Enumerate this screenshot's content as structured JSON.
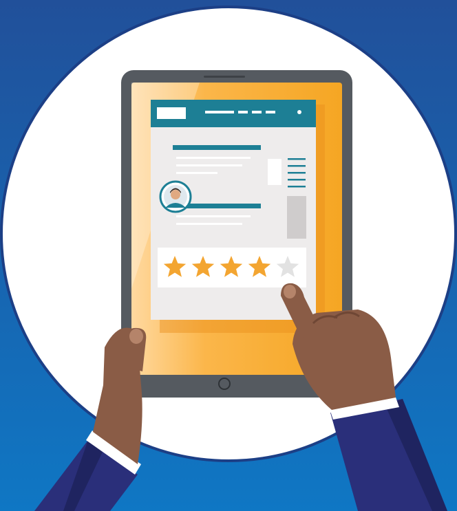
{
  "palette": {
    "background_top": "#21509a",
    "background_bottom": "#0f77c4",
    "circle": "#ffffff",
    "tablet_frame": "#555a60",
    "tablet_screen_orange": "#f5a623",
    "header_teal": "#1d7f95",
    "card_gray": "#eeecec",
    "star_filled": "#f3a531",
    "star_empty": "#e2e2e2",
    "skin": "#8a5c46",
    "sleeve": "#2a2f7a",
    "cuff": "#ffffff"
  },
  "rating": {
    "value": 4,
    "max": 5
  },
  "icons": {
    "avatar": "user-avatar-icon",
    "star": "star-icon",
    "home_button": "home-button-icon"
  }
}
